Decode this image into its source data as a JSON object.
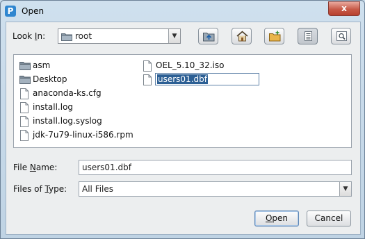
{
  "window": {
    "title": "Open",
    "app_icon": "P",
    "close_label": "x"
  },
  "look_in": {
    "label_pre": "Look ",
    "label_mnemonic": "I",
    "label_post": "n:",
    "value": "root"
  },
  "toolbar": {
    "buttons": [
      {
        "name": "up-one-level",
        "icon": "folder-up-icon"
      },
      {
        "name": "home",
        "icon": "home-icon"
      },
      {
        "name": "create-new-folder",
        "icon": "new-folder-icon"
      },
      {
        "name": "list-view",
        "icon": "list-view-icon",
        "active": true
      },
      {
        "name": "details-view",
        "icon": "details-view-icon"
      }
    ]
  },
  "files": {
    "column1": [
      {
        "name": "asm",
        "type": "folder"
      },
      {
        "name": "Desktop",
        "type": "folder"
      },
      {
        "name": "anaconda-ks.cfg",
        "type": "file"
      },
      {
        "name": "install.log",
        "type": "file"
      },
      {
        "name": "install.log.syslog",
        "type": "file"
      },
      {
        "name": "jdk-7u79-linux-i586.rpm",
        "type": "file"
      }
    ],
    "column2": [
      {
        "name": "OEL_5.10_32.iso",
        "type": "file"
      },
      {
        "name": "users01.dbf",
        "type": "file",
        "editing": true
      }
    ]
  },
  "file_name": {
    "label_pre": "File ",
    "label_mnemonic": "N",
    "label_post": "ame:",
    "value": "users01.dbf"
  },
  "files_of_type": {
    "label_pre": "Files of ",
    "label_mnemonic": "T",
    "label_post": "ype:",
    "value": "All Files"
  },
  "actions": {
    "open_mnemonic": "O",
    "open_rest": "pen",
    "cancel": "Cancel"
  },
  "colors": {
    "selection": "#2c5f94",
    "titlebar": "#c9dbe9",
    "close": "#c75a48"
  }
}
